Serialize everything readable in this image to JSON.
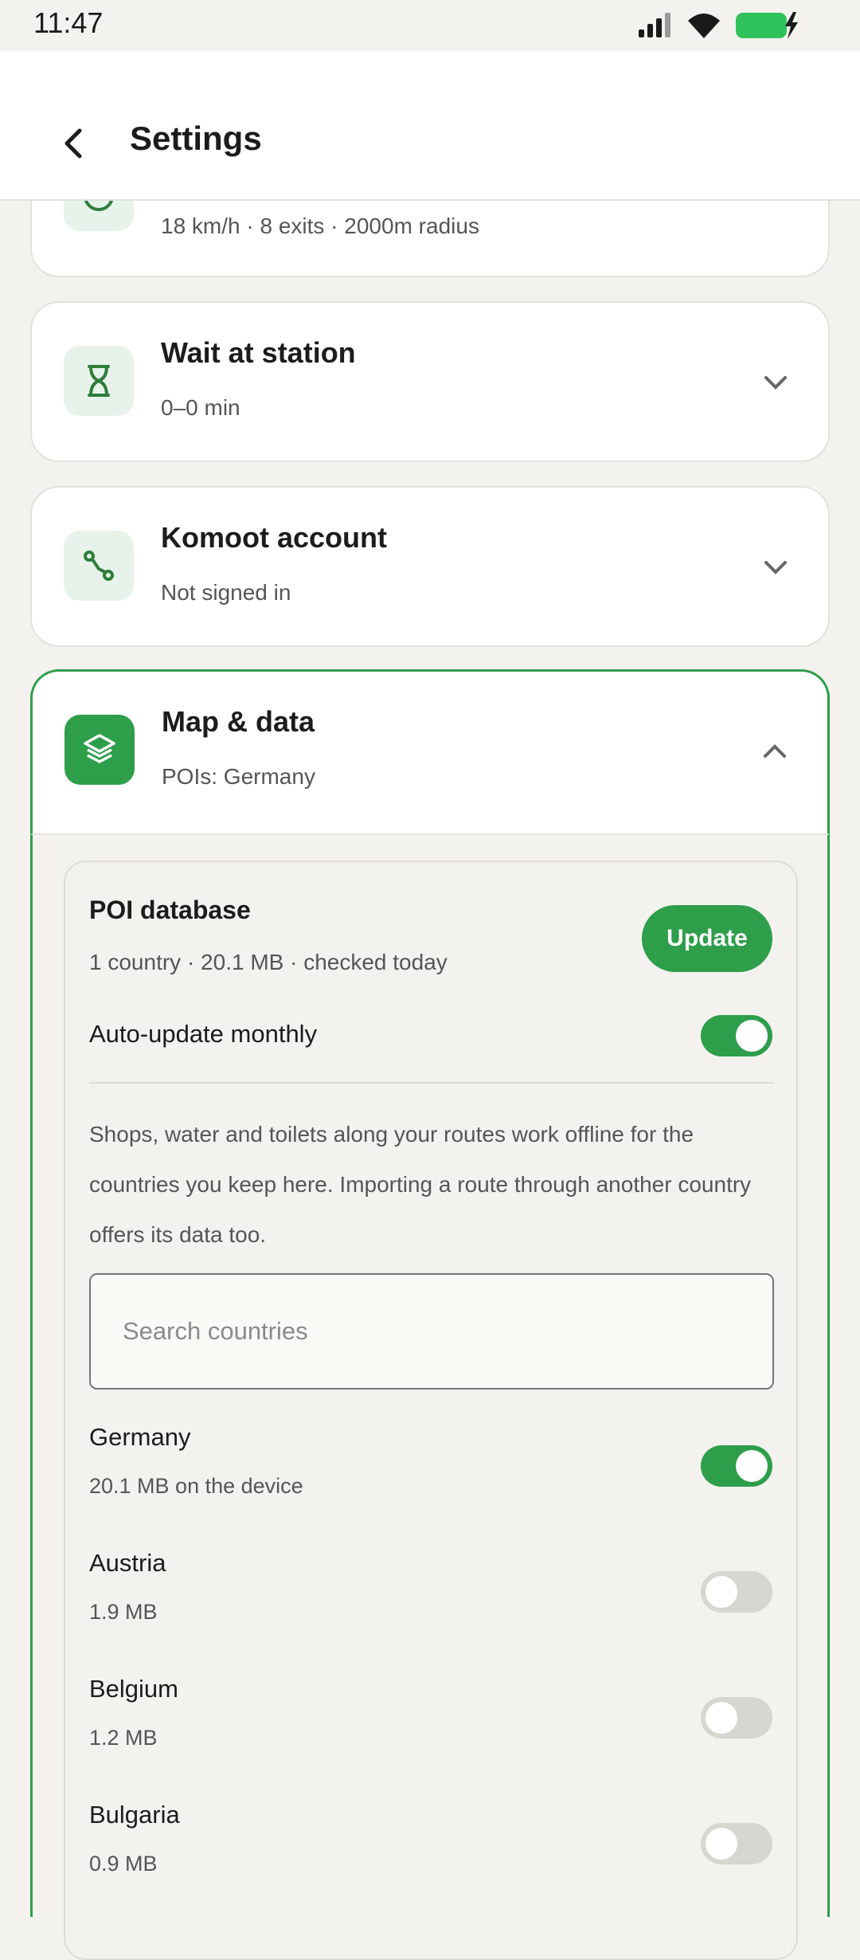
{
  "status": {
    "time": "11:47"
  },
  "header": {
    "title": "Settings"
  },
  "cards": {
    "speed": {
      "subtitle": "18 km/h · 8 exits · 2000m radius"
    },
    "wait": {
      "title": "Wait at station",
      "subtitle": "0–0 min"
    },
    "komoot": {
      "title": "Komoot account",
      "subtitle": "Not signed in"
    },
    "map": {
      "title": "Map & data",
      "subtitle": "POIs: Germany"
    }
  },
  "poi": {
    "title": "POI database",
    "subtitle": "1 country · 20.1 MB · checked today",
    "update_label": "Update",
    "auto_update_label": "Auto-update monthly",
    "auto_update_on": true,
    "description": "Shops, water and toilets along your routes work offline for the countries you keep here. Importing a route through another country offers its data too.",
    "search_placeholder": "Search countries"
  },
  "countries": [
    {
      "name": "Germany",
      "size": "20.1 MB on the device",
      "enabled": true
    },
    {
      "name": "Austria",
      "size": "1.9 MB",
      "enabled": false
    },
    {
      "name": "Belgium",
      "size": "1.2 MB",
      "enabled": false
    },
    {
      "name": "Bulgaria",
      "size": "0.9 MB",
      "enabled": false
    }
  ],
  "colors": {
    "accent": "#2e9e4b",
    "icon_bg": "#e7f3ea",
    "background": "#f3f2ee"
  }
}
